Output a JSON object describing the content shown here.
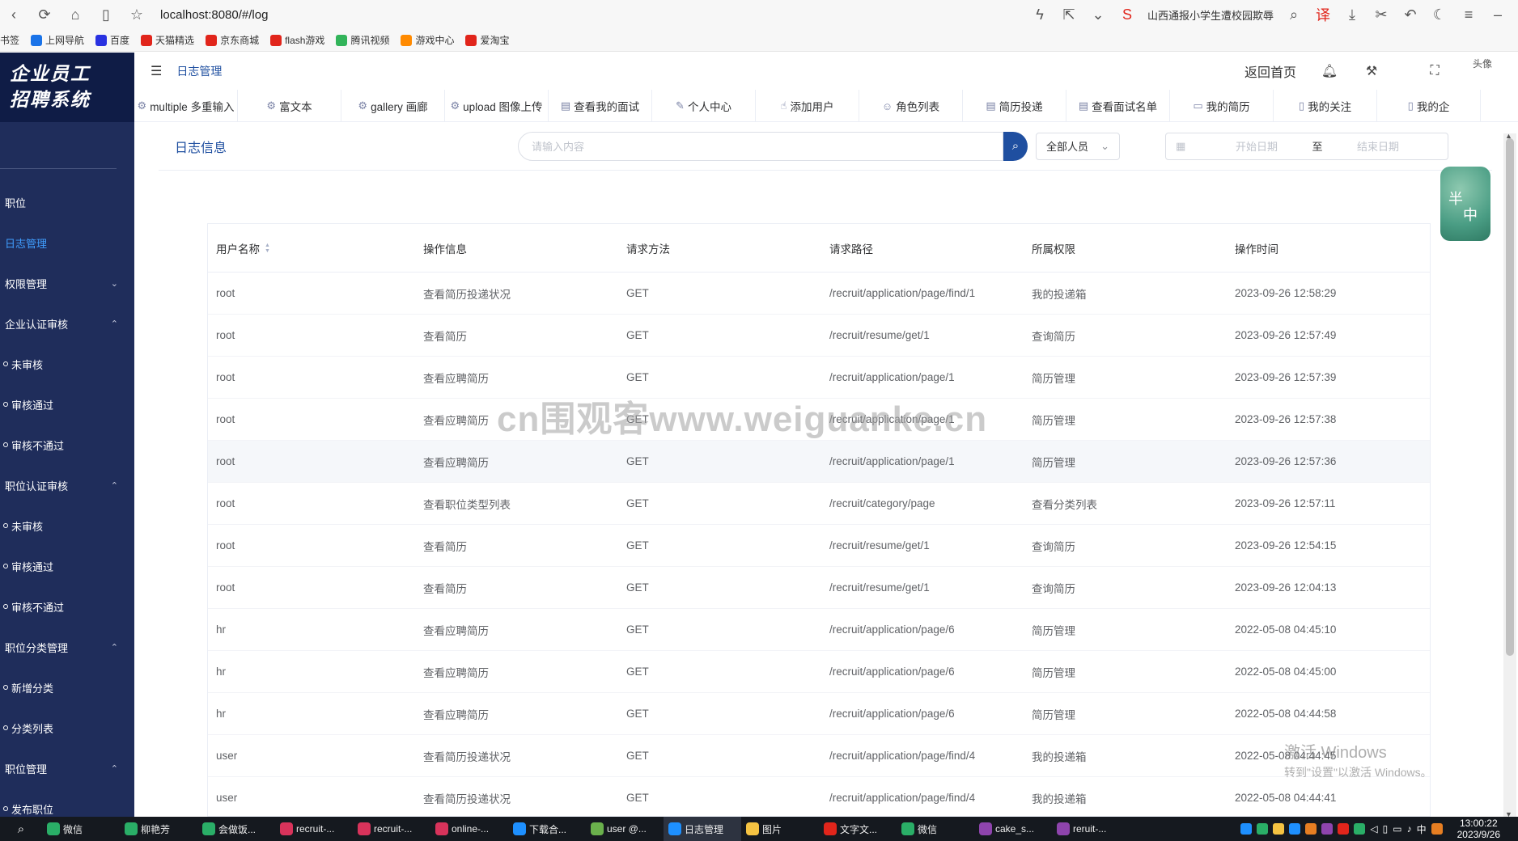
{
  "browser": {
    "url": "localhost:8080/#/log",
    "hot_search": "山西通报小学生遭校园欺辱"
  },
  "bookmarks": [
    {
      "label": "书签",
      "color": "#f7f7f7"
    },
    {
      "label": "上网导航",
      "color": "#1a73e8"
    },
    {
      "label": "百度",
      "color": "#2932e1"
    },
    {
      "label": "天猫精选",
      "color": "#e1251b"
    },
    {
      "label": "京东商城",
      "color": "#e1251b"
    },
    {
      "label": "flash游戏",
      "color": "#e1251b"
    },
    {
      "label": "腾讯视频",
      "color": "#32b45a"
    },
    {
      "label": "游戏中心",
      "color": "#ff8a00"
    },
    {
      "label": "爱淘宝",
      "color": "#e1251b"
    }
  ],
  "sidebar": {
    "logo_line1": "企业员工",
    "logo_line2": "招聘系统",
    "items": [
      {
        "label": "职位",
        "type": "item"
      },
      {
        "label": "日志管理",
        "type": "item",
        "active": true
      },
      {
        "label": "权限管理",
        "type": "group",
        "chev": "⌄"
      },
      {
        "label": "企业认证审核",
        "type": "group",
        "chev": "⌃"
      },
      {
        "label": "未审核",
        "type": "sub"
      },
      {
        "label": "审核通过",
        "type": "sub"
      },
      {
        "label": "审核不通过",
        "type": "sub"
      },
      {
        "label": "职位认证审核",
        "type": "group",
        "chev": "⌃"
      },
      {
        "label": "未审核",
        "type": "sub"
      },
      {
        "label": "审核通过",
        "type": "sub"
      },
      {
        "label": "审核不通过",
        "type": "sub"
      },
      {
        "label": "职位分类管理",
        "type": "group",
        "chev": "⌃"
      },
      {
        "label": "新增分类",
        "type": "sub"
      },
      {
        "label": "分类列表",
        "type": "sub"
      },
      {
        "label": "职位管理",
        "type": "group",
        "chev": "⌃"
      },
      {
        "label": "发布职位",
        "type": "sub"
      }
    ]
  },
  "header": {
    "breadcrumb": "日志管理",
    "home_link": "返回首页",
    "avatar_text": "头像"
  },
  "tabs": [
    {
      "label": "multiple 多重输入",
      "icon": "⚙"
    },
    {
      "label": "富文本",
      "icon": "⚙"
    },
    {
      "label": "gallery 画廊",
      "icon": "⚙"
    },
    {
      "label": "upload 图像上传",
      "icon": "⚙"
    },
    {
      "label": "查看我的面试",
      "icon": "▤"
    },
    {
      "label": "个人中心",
      "icon": "✎"
    },
    {
      "label": "添加用户",
      "icon": "☝"
    },
    {
      "label": "角色列表",
      "icon": "☺"
    },
    {
      "label": "简历投递",
      "icon": "▤"
    },
    {
      "label": "查看面试名单",
      "icon": "▤"
    },
    {
      "label": "我的简历",
      "icon": "▭"
    },
    {
      "label": "我的关注",
      "icon": "▯"
    },
    {
      "label": "我的企",
      "icon": "▯"
    }
  ],
  "panel": {
    "title": "日志信息",
    "search_placeholder": "请输入内容",
    "select_value": "全部人员",
    "start_placeholder": "开始日期",
    "range_sep": "至",
    "end_placeholder": "结束日期"
  },
  "table": {
    "columns": [
      "用户名称",
      "操作信息",
      "请求方法",
      "请求路径",
      "所属权限",
      "操作时间"
    ],
    "rows": [
      [
        "root",
        "查看简历投递状况",
        "GET",
        "/recruit/application/page/find/1",
        "我的投递箱",
        "2023-09-26 12:58:29"
      ],
      [
        "root",
        "查看简历",
        "GET",
        "/recruit/resume/get/1",
        "查询简历",
        "2023-09-26 12:57:49"
      ],
      [
        "root",
        "查看应聘简历",
        "GET",
        "/recruit/application/page/1",
        "简历管理",
        "2023-09-26 12:57:39"
      ],
      [
        "root",
        "查看应聘简历",
        "GET",
        "/recruit/application/page/1",
        "简历管理",
        "2023-09-26 12:57:38"
      ],
      [
        "root",
        "查看应聘简历",
        "GET",
        "/recruit/application/page/1",
        "简历管理",
        "2023-09-26 12:57:36"
      ],
      [
        "root",
        "查看职位类型列表",
        "GET",
        "/recruit/category/page",
        "查看分类列表",
        "2023-09-26 12:57:11"
      ],
      [
        "root",
        "查看简历",
        "GET",
        "/recruit/resume/get/1",
        "查询简历",
        "2023-09-26 12:54:15"
      ],
      [
        "root",
        "查看简历",
        "GET",
        "/recruit/resume/get/1",
        "查询简历",
        "2023-09-26 12:04:13"
      ],
      [
        "hr",
        "查看应聘简历",
        "GET",
        "/recruit/application/page/6",
        "简历管理",
        "2022-05-08 04:45:10"
      ],
      [
        "hr",
        "查看应聘简历",
        "GET",
        "/recruit/application/page/6",
        "简历管理",
        "2022-05-08 04:45:00"
      ],
      [
        "hr",
        "查看应聘简历",
        "GET",
        "/recruit/application/page/6",
        "简历管理",
        "2022-05-08 04:44:58"
      ],
      [
        "user",
        "查看简历投递状况",
        "GET",
        "/recruit/application/page/find/4",
        "我的投递箱",
        "2022-05-08 04:44:45"
      ],
      [
        "user",
        "查看简历投递状况",
        "GET",
        "/recruit/application/page/find/4",
        "我的投递箱",
        "2022-05-08 04:44:41"
      ]
    ]
  },
  "ime_widget": {
    "line1": "半",
    "line2": "中"
  },
  "watermark": "cn围观客www.weiguanke.cn",
  "windows_activation": {
    "line1": "激活 Windows",
    "line2": "转到\"设置\"以激活 Windows。"
  },
  "taskbar": {
    "tasks": [
      {
        "label": "微信",
        "color": "#2aae67"
      },
      {
        "label": "柳艳芳",
        "color": "#2aae67"
      },
      {
        "label": "会做饭...",
        "color": "#2aae67"
      },
      {
        "label": "recruit-...",
        "color": "#d8335b"
      },
      {
        "label": "recruit-...",
        "color": "#d8335b"
      },
      {
        "label": "online-...",
        "color": "#d8335b"
      },
      {
        "label": "下载合...",
        "color": "#1e90ff"
      },
      {
        "label": "user @...",
        "color": "#6ab04c"
      },
      {
        "label": "日志管理",
        "color": "#1e90ff",
        "active": true
      },
      {
        "label": "图片",
        "color": "#f5c342"
      },
      {
        "label": "文字文...",
        "color": "#e1251b"
      },
      {
        "label": "微信",
        "color": "#2aae67"
      },
      {
        "label": "cake_s...",
        "color": "#8e44ad"
      },
      {
        "label": "reruit-...",
        "color": "#8e44ad"
      }
    ],
    "ime": "中",
    "time": "13:00:22",
    "date": "2023/9/26"
  }
}
